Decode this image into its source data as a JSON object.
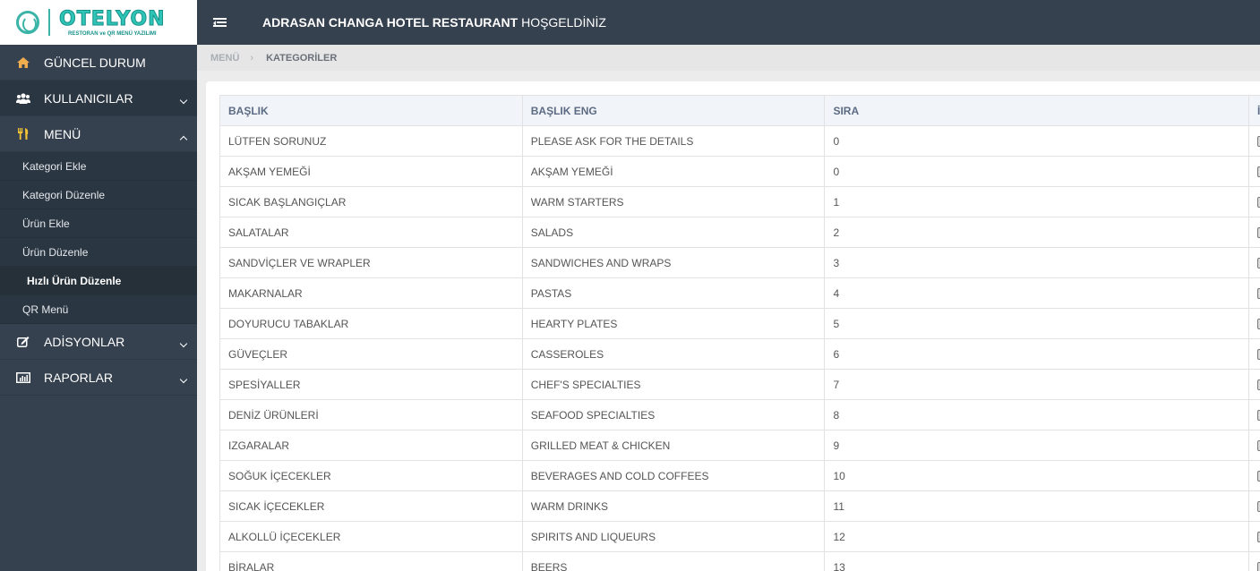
{
  "brand": {
    "name": "OTELYON",
    "tagline": "RESTORAN ve QR MENÜ YAZILIMI",
    "accent_color": "#3bb4a7"
  },
  "topbar": {
    "menu_icon": "hamburger-toggle-icon",
    "title_bold": "ADRASAN CHANGA HOTEL RESTAURANT",
    "title_rest": " HOŞGELDİNİZ"
  },
  "sidebar": {
    "items": [
      {
        "label": "GÜNCEL DURUM",
        "icon": "home-icon",
        "icon_color": "#f0ad4e"
      },
      {
        "label": "KULLANICILAR",
        "icon": "users-icon",
        "expandable": true,
        "expanded": false
      },
      {
        "label": "MENÜ",
        "icon": "cutlery-icon",
        "icon_color": "#f3c433",
        "expandable": true,
        "expanded": true
      },
      {
        "label": "ADİSYONLAR",
        "icon": "edit-icon",
        "expandable": true,
        "expanded": false
      },
      {
        "label": "RAPORLAR",
        "icon": "bar-chart-icon",
        "expandable": true,
        "expanded": false
      }
    ],
    "menu_sub": [
      {
        "label": "Kategori Ekle"
      },
      {
        "label": "Kategori Düzenle"
      },
      {
        "label": "Ürün Ekle"
      },
      {
        "label": "Ürün Düzenle"
      },
      {
        "label": "Hızlı Ürün Düzenle",
        "active": true
      },
      {
        "label": "QR Menü"
      }
    ]
  },
  "breadcrumb": {
    "parent": "MENÜ",
    "separator": "›",
    "current": "KATEGORİLER"
  },
  "table": {
    "headers": [
      "BAŞLIK",
      "BAŞLIK ENG",
      "SIRA",
      "İ"
    ],
    "rows": [
      {
        "baslik": "LÜTFEN SORUNUZ",
        "baslik_eng": "PLEASE ASK FOR THE DETAILS",
        "sira": "0"
      },
      {
        "baslik": "AKŞAM YEMEĞİ",
        "baslik_eng": "AKŞAM YEMEĞİ",
        "sira": "0"
      },
      {
        "baslik": "SICAK BAŞLANGIÇLAR",
        "baslik_eng": "WARM STARTERS",
        "sira": "1"
      },
      {
        "baslik": "SALATALAR",
        "baslik_eng": "SALADS",
        "sira": "2"
      },
      {
        "baslik": "SANDVİÇLER VE WRAPLER",
        "baslik_eng": "SANDWICHES AND WRAPS",
        "sira": "3"
      },
      {
        "baslik": "MAKARNALAR",
        "baslik_eng": "PASTAS",
        "sira": "4"
      },
      {
        "baslik": "DOYURUCU TABAKLAR",
        "baslik_eng": "HEARTY PLATES",
        "sira": "5"
      },
      {
        "baslik": "GÜVEÇLER",
        "baslik_eng": "CASSEROLES",
        "sira": "6"
      },
      {
        "baslik": "SPESİYALLER",
        "baslik_eng": "CHEF'S SPECIALTIES",
        "sira": "7"
      },
      {
        "baslik": "DENİZ ÜRÜNLERİ",
        "baslik_eng": "SEAFOOD SPECIALTIES",
        "sira": "8"
      },
      {
        "baslik": "IZGARALAR",
        "baslik_eng": "GRILLED MEAT & CHICKEN",
        "sira": "9"
      },
      {
        "baslik": "SOĞUK İÇECEKLER",
        "baslik_eng": "BEVERAGES AND COLD COFFEES",
        "sira": "10"
      },
      {
        "baslik": "SICAK İÇECEKLER",
        "baslik_eng": "WARM DRINKS",
        "sira": "11"
      },
      {
        "baslik": "ALKOLLÜ İÇECEKLER",
        "baslik_eng": "SPIRITS AND LIQUEURS",
        "sira": "12"
      },
      {
        "baslik": "BİRALAR",
        "baslik_eng": "BEERS",
        "sira": "13"
      }
    ]
  }
}
